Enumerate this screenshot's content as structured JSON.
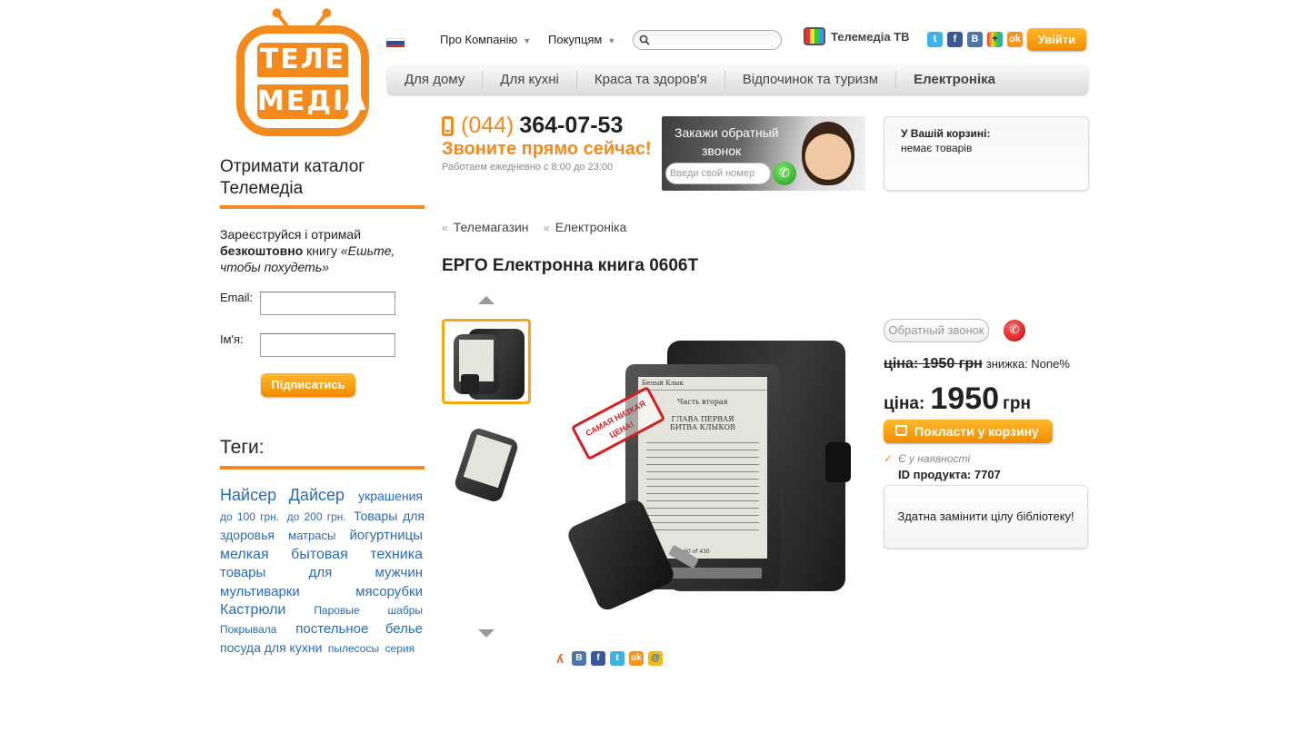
{
  "logo": {
    "line1": "ТЕЛЕ",
    "line2": "МЕДІА"
  },
  "topmenu": {
    "about": "Про Компанію",
    "customers": "Покупцям",
    "search_placeholder": "",
    "tv_link": "Телемедіа ТВ",
    "enter": "Увійти"
  },
  "social_icons": [
    "twitter-icon",
    "facebook-icon",
    "vkontakte-icon",
    "google-plus-icon",
    "odnoklassniki-icon"
  ],
  "mainnav": [
    "Для дому",
    "Для кухні",
    "Краса та здоров'я",
    "Відпочинок та туризм",
    "Електроніка"
  ],
  "phone": {
    "code": "(044)",
    "number": "364-07-53",
    "call_now": "Звоните прямо сейчас!",
    "hours": "Работаем ежедневно с 8:00 до 23:00"
  },
  "callback_banner": {
    "title1": "Закажи обратный",
    "title2": "звонок",
    "input_placeholder": "Введи свой номер"
  },
  "cart": {
    "title": "У Вашій корзині:",
    "status": "немає товарів"
  },
  "sidebar": {
    "catalog_title_1": "Отримати каталог",
    "catalog_title_2": "Телемедіа",
    "reg_1": "Зареєструйся і отримай",
    "reg_bold": "безкоштовно",
    "reg_2": "книгу",
    "reg_italic": "«Ешьте, чтобы похудеть»",
    "email_label": "Email:",
    "name_label": "Ім'я:",
    "subscribe": "Підписатись",
    "tags_title": "Теги:",
    "tags": [
      {
        "text": "Найсер Дайсер",
        "size": 18
      },
      {
        "text": "украшения",
        "size": 14
      },
      {
        "text": "до 100 грн.",
        "size": 12
      },
      {
        "text": "до 200 грн.",
        "size": 12
      },
      {
        "text": "Товары для здоровья",
        "size": 14
      },
      {
        "text": "матрасы",
        "size": 13
      },
      {
        "text": "йогуртницы",
        "size": 15
      },
      {
        "text": "мелкая бытовая техника",
        "size": 16
      },
      {
        "text": "товары для мужчин",
        "size": 15
      },
      {
        "text": "мультиварки",
        "size": 15
      },
      {
        "text": "мясорубки",
        "size": 15
      },
      {
        "text": "Кастрюли",
        "size": 16
      },
      {
        "text": "Паровые",
        "size": 12
      },
      {
        "text": "шабры",
        "size": 12
      },
      {
        "text": "Покрывала",
        "size": 12
      },
      {
        "text": "постельное белье",
        "size": 15
      },
      {
        "text": "посуда для кухни",
        "size": 14
      },
      {
        "text": "пылесосы",
        "size": 12
      },
      {
        "text": "серия",
        "size": 12
      }
    ]
  },
  "breadcrumb": [
    "Телемагазин",
    "Електроніка"
  ],
  "product": {
    "title": "ЕРГО Електронна книга 0606T",
    "callback_btn": "Обратный звонок",
    "old_price_label": "ціна:",
    "old_price": "1950 грн",
    "discount": "знижка: None%",
    "price_label": "ціна:",
    "price": "1950",
    "currency": "грн",
    "add_to_cart": "Покласти у корзину",
    "in_stock": "Є у наявності",
    "product_id": "ID продукта: 7707",
    "description": "Здатна замінити цілу бібліотеку!",
    "stamp": "САМАЯ НИЗКАЯ ЦЕНА!",
    "screen_header": "Белый Клык",
    "screen_part": "Часть вторая",
    "screen_chapter": "ГЛАВА ПЕРВАЯ",
    "screen_chapter2": "БИТВА КЛЫКОВ",
    "screen_pages": "60 of 430"
  },
  "share_icons": [
    "odnoklassniki-person-icon",
    "vkontakte-icon",
    "facebook-icon",
    "twitter-icon",
    "odnoklassniki-icon",
    "mail-icon"
  ],
  "colors": {
    "accent": "#f28a1e",
    "link": "#2a6bb8"
  }
}
